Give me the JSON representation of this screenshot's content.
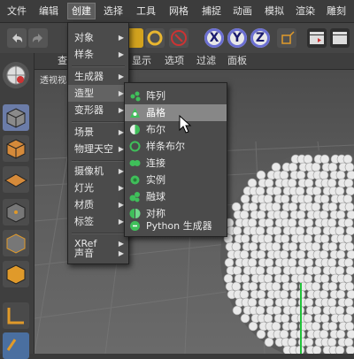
{
  "menubar": {
    "items": [
      "文件",
      "编辑",
      "创建",
      "选择",
      "工具",
      "网格",
      "捕捉",
      "动画",
      "模拟",
      "渲染",
      "雕刻"
    ]
  },
  "viewport": {
    "menu": [
      "查",
      "显示",
      "选项",
      "过滤",
      "面板"
    ],
    "label": "透视视"
  },
  "create_menu": {
    "items": [
      {
        "label": "对象",
        "submenu": true
      },
      {
        "label": "样条",
        "submenu": true
      },
      {
        "label": "生成器",
        "submenu": true
      },
      {
        "label": "造型",
        "submenu": true
      },
      {
        "label": "变形器",
        "submenu": true
      },
      {
        "label": "场景",
        "submenu": true
      },
      {
        "label": "物理天空",
        "submenu": true
      },
      {
        "label": "摄像机",
        "submenu": true
      },
      {
        "label": "灯光",
        "submenu": true
      },
      {
        "label": "材质",
        "submenu": true
      },
      {
        "label": "标签",
        "submenu": true
      },
      {
        "label": "XRef",
        "submenu": true
      },
      {
        "label": "声音",
        "submenu": true
      }
    ]
  },
  "mograph_menu": {
    "items": [
      {
        "label": "阵列",
        "icon": "array-icon"
      },
      {
        "label": "晶格",
        "icon": "atom-array-icon"
      },
      {
        "label": "布尔",
        "icon": "boole-icon"
      },
      {
        "label": "样条布尔",
        "icon": "spline-mask-icon"
      },
      {
        "label": "连接",
        "icon": "connect-icon"
      },
      {
        "label": "实例",
        "icon": "instance-icon"
      },
      {
        "label": "融球",
        "icon": "metaball-icon"
      },
      {
        "label": "对称",
        "icon": "symmetry-icon"
      },
      {
        "label": "Python 生成器",
        "icon": "python-icon"
      }
    ],
    "selected": "晶格"
  },
  "toolbar": {
    "axis_buttons": [
      "X",
      "Y",
      "Z"
    ]
  },
  "colors": {
    "menu_bg": "#4b4b4b",
    "highlight": "#878787",
    "icon_green": "#3fbf5a",
    "axis_button": "#6b6fd1"
  }
}
